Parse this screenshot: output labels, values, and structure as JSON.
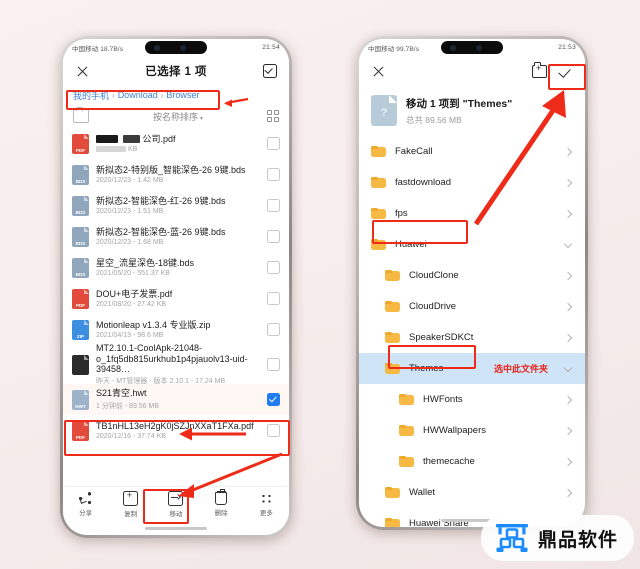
{
  "background": {
    "accent_red": "#ee2b18",
    "link_blue": "#3f7fd4",
    "select_blue": "#1f7cf2",
    "folder_yellow": "#f5b944"
  },
  "left_phone": {
    "status_bar": {
      "left": "中国移动 18.7B/s",
      "right": "21:54"
    },
    "appbar": {
      "close_icon": "close-icon",
      "title": "已选择 1 项",
      "select_all_icon": "select-all-icon"
    },
    "breadcrumb": {
      "items": [
        "我的手机",
        "Download",
        "Browser"
      ],
      "separator": "›"
    },
    "sort_bar": {
      "left_icon": "folder-icon",
      "label": "按名称排序",
      "caret": "▾",
      "grid_icon": "grid-view-icon"
    },
    "files": [
      {
        "name": "公司.pdf",
        "meta": "KB",
        "type": "pdf",
        "redacted": true,
        "checked": false
      },
      {
        "name": "新拟态2-特别版_智能深色-26 9键.bds",
        "meta": "2020/12/23 - 1.42 MB",
        "type": "bds",
        "checked": false
      },
      {
        "name": "新拟态2-智能深色-红-26 9键.bds",
        "meta": "2020/12/23 - 1.51 MB",
        "type": "bds",
        "checked": false
      },
      {
        "name": "新拟态2-智能深色-蓝-26 9键.bds",
        "meta": "2020/12/23 - 1.68 MB",
        "type": "bds",
        "checked": false
      },
      {
        "name": "星空_流星深色-18键.bds",
        "meta": "2021/05/20 - 551.37 KB",
        "type": "bds",
        "checked": false
      },
      {
        "name": "DOU+电子发票.pdf",
        "meta": "2021/08/20 - 27.42 KB",
        "type": "pdf",
        "checked": false
      },
      {
        "name": "Motionleap v1.3.4 专业版.zip",
        "meta": "2021/04/13 - 98.6 MB",
        "type": "zip",
        "checked": false
      },
      {
        "name": "MT2.10.1-CoolApk-21048-o_1fq5db815urkhub1p4pjauolv13-uid-39458…",
        "meta": "昨天 - MT管理器 - 版本 2.10.1 - 17.24 MB",
        "type": "apk",
        "checked": false
      },
      {
        "name": "S21青空.hwt",
        "meta": "1 分钟前 - 89.56 MB",
        "type": "hwt",
        "checked": true,
        "highlighted": true
      },
      {
        "name": "TB1nHL13eH2gK0jSZJnXXaT1FXa.pdf",
        "meta": "2020/12/16 - 37.74 KB",
        "type": "pdf",
        "checked": false
      }
    ],
    "toolbar": [
      {
        "label": "分享",
        "icon": "share-icon"
      },
      {
        "label": "复制",
        "icon": "copy-icon"
      },
      {
        "label": "移动",
        "icon": "move-icon",
        "highlighted": true
      },
      {
        "label": "删除",
        "icon": "delete-icon"
      },
      {
        "label": "更多",
        "icon": "more-icon"
      }
    ]
  },
  "right_phone": {
    "status_bar": {
      "left": "中国移动 99.7B/s",
      "right": "21:53"
    },
    "appbar": {
      "close_icon": "close-icon",
      "new_folder_icon": "new-folder-icon",
      "confirm_icon": "confirm-check-icon"
    },
    "move_banner": {
      "title": "移动 1 项到 \"Themes\"",
      "subtitle": "总共 89.56 MB",
      "icon": "unknown-file-icon"
    },
    "folders": [
      {
        "name": "FakeCall",
        "indent": 0,
        "chevron": "right"
      },
      {
        "name": "fastdownload",
        "indent": 0,
        "chevron": "right"
      },
      {
        "name": "fps",
        "indent": 0,
        "chevron": "right"
      },
      {
        "name": "Huawei",
        "indent": 0,
        "chevron": "down",
        "boxed": true
      },
      {
        "name": "CloudClone",
        "indent": 1,
        "chevron": "right"
      },
      {
        "name": "CloudDrive",
        "indent": 1,
        "chevron": "right"
      },
      {
        "name": "SpeakerSDKCt",
        "indent": 1,
        "chevron": "right"
      },
      {
        "name": "Themes",
        "indent": 1,
        "chevron": "down",
        "selected": true,
        "boxed": true,
        "annotation": "选中此文件夹"
      },
      {
        "name": "HWFonts",
        "indent": 2,
        "chevron": "right"
      },
      {
        "name": "HWWallpapers",
        "indent": 2,
        "chevron": "right"
      },
      {
        "name": "themecache",
        "indent": 2,
        "chevron": "right"
      },
      {
        "name": "Wallet",
        "indent": 1,
        "chevron": "right"
      },
      {
        "name": "Huawei Share",
        "indent": 1,
        "chevron": "right"
      }
    ]
  },
  "watermark": {
    "text": "鼎品软件",
    "logo": "dingpin-logo-icon",
    "color": "#1a8cff"
  }
}
